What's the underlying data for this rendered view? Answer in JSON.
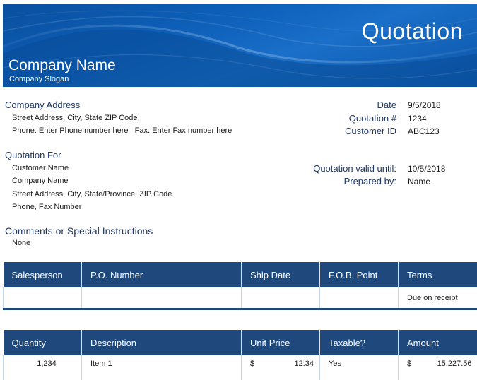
{
  "banner": {
    "title": "Quotation",
    "company_name": "Company Name",
    "company_slogan": "Company Slogan"
  },
  "company_address": {
    "heading": "Company Address",
    "street": "Street Address, City, State ZIP Code",
    "contact": "Phone: Enter Phone number here   Fax: Enter Fax number here"
  },
  "meta": {
    "date_label": "Date",
    "date_value": "9/5/2018",
    "quotation_label": "Quotation #",
    "quotation_value": "1234",
    "customer_id_label": "Customer ID",
    "customer_id_value": "ABC123",
    "valid_until_label": "Quotation valid until:",
    "valid_until_value": "10/5/2018",
    "prepared_by_label": "Prepared by:",
    "prepared_by_value": "Name"
  },
  "quotation_for": {
    "heading": "Quotation For",
    "customer_name": "Customer Name",
    "company_name": "Company Name",
    "street": "Street Address, City, State/Province, ZIP Code",
    "phone_fax": "Phone, Fax Number"
  },
  "comments": {
    "heading": "Comments or Special Instructions",
    "value": "None"
  },
  "sales_table": {
    "headers": [
      "Salesperson",
      "P.O. Number",
      "Ship Date",
      "F.O.B. Point",
      "Terms"
    ],
    "row": [
      "",
      "",
      "",
      "",
      "Due on receipt"
    ]
  },
  "items_table": {
    "headers": [
      "Quantity",
      "Description",
      "Unit Price",
      "Taxable?",
      "Amount"
    ],
    "rows": [
      {
        "quantity": "1,234",
        "description": "Item 1",
        "unit_price_currency": "$",
        "unit_price": "12.34",
        "taxable": "Yes",
        "amount_currency": "$",
        "amount": "15,227.56"
      }
    ]
  }
}
